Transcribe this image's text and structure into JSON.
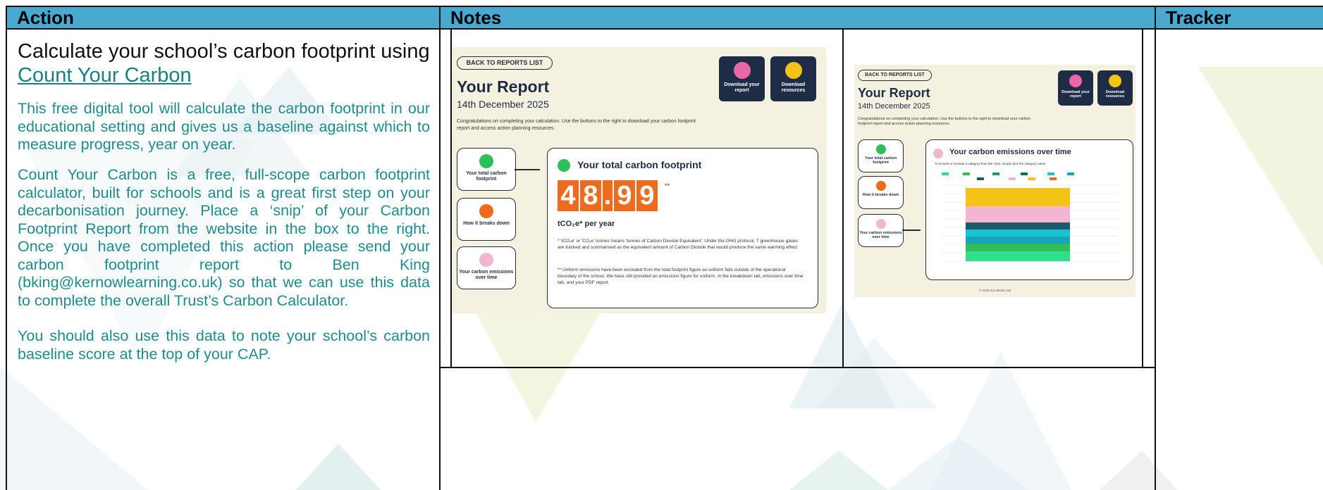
{
  "header": {
    "action": "Action",
    "notes": "Notes",
    "tracker": "Tracker"
  },
  "action": {
    "title_pre": "Calculate your school’s carbon footprint using ",
    "title_link": "Count Your Carbon",
    "paragraphs": [
      "This free digital tool will calculate the carbon footprint in our educational setting and gives us a baseline against which to measure progress, year on year.",
      "Count Your Carbon is a free, full-scope carbon footprint calculator, built for schools and is a great first step on your decarbonisation journey.  Place a ‘snip’ of your Carbon Footprint Report from the website in the box to the right. Once you have completed this action please send your carbon footprint report to Ben King (bking@kernowlearning.co.uk) so that we can use this data to complete the overall Trust’s Carbon Calculator.",
      "You should also use this data to note your school’s carbon baseline score at the top of your CAP."
    ]
  },
  "report1": {
    "back": "BACK TO REPORTS LIST",
    "title": "Your Report",
    "date": "14th December 2025",
    "intro": "Congratulations on completing your calculation. Use the buttons to the right to download your carbon footprint report and access action planning resources.",
    "download_report": "Download your report",
    "download_resources": "Download resources",
    "side": [
      "Your total carbon footprint",
      "How it breaks down",
      "Your carbon emissions over time"
    ],
    "panel_title": "Your total carbon footprint",
    "digits": [
      "4",
      "8",
      ".",
      "9",
      "9"
    ],
    "stars": "**",
    "unit": "tCO₂e* per year",
    "note1": "* 'tCO₂e' or 'CO₂e' tonnes means 'tonnes of Carbon Dioxide Equivalent'. Under the GHG protocol, 7 greenhouse gases are tracked and summarised as the equivalent amount of Carbon Dioxide that would produce the same warming effect",
    "note2": "** Uniform emissions have been excluded from the total footprint figure as uniform falls outside of the operational boundary of the school. We have still provided an emissions figure for uniform, in the breakdown tab, emissions over time tab, and your PDF report."
  },
  "report2": {
    "back": "BACK TO REPORTS LIST",
    "title": "Your Report",
    "date": "14th December 2025",
    "intro": "Congratulations on completing your calculation. Use the buttons to the right to download your carbon footprint report and access action planning resources.",
    "download_report": "Download your report",
    "download_resources": "Download resources",
    "side": [
      "Your total carbon footprint",
      "How it breaks down",
      "Your carbon emissions over time"
    ],
    "panel_title": "Your carbon emissions over time",
    "panel_hint": "To include or exclude a category from the chart, simply click the category name.",
    "footer": "© 2025 Eco Brainz Ltd"
  },
  "colors": {
    "header_bg": "#4aa9cf",
    "action_text": "#1f8b8b",
    "navy": "#1e2c45",
    "orange": "#ee6a1c",
    "green": "#2fbf5a",
    "pink": "#f3b6d2",
    "report_bg": "#f5f1e1"
  }
}
